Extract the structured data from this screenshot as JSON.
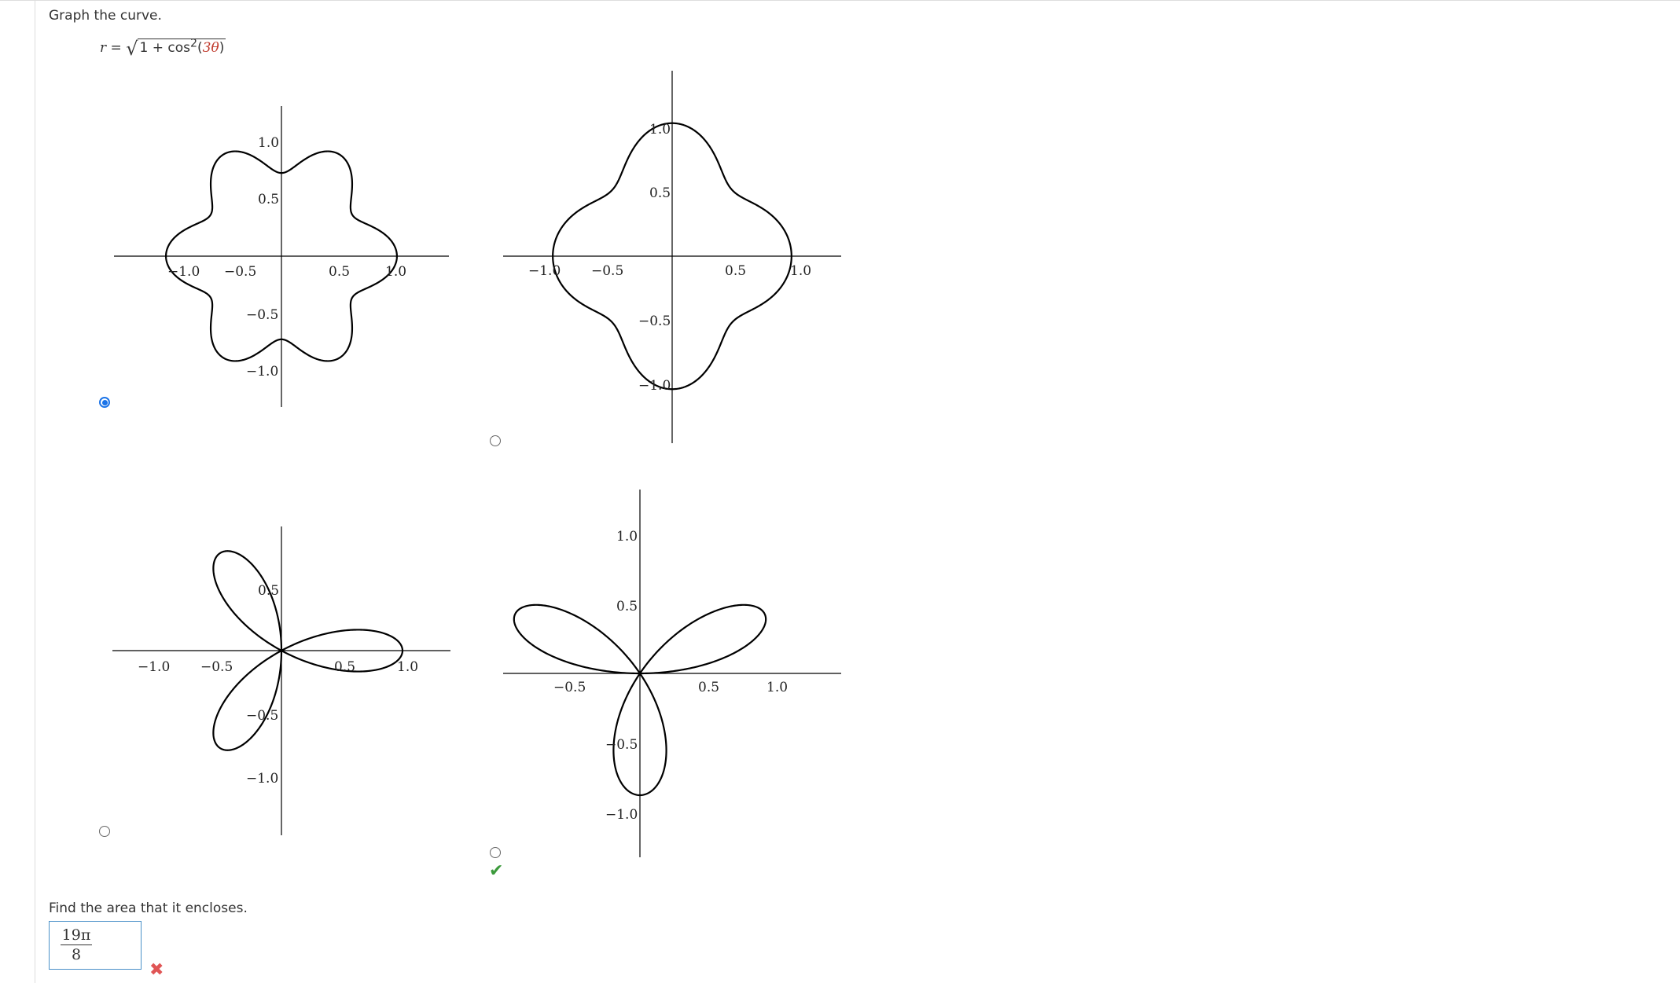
{
  "question": {
    "prompt": "Graph the curve.",
    "equation": {
      "lhs": "r =",
      "radicand_prefix": "1 + cos",
      "exponent": "2",
      "arg_open": "(",
      "arg_colored": "3θ",
      "arg_close": ")"
    }
  },
  "options": [
    {
      "id": "A",
      "selected": true,
      "marked_correct": false
    },
    {
      "id": "B",
      "selected": false,
      "marked_correct": false
    },
    {
      "id": "C",
      "selected": false,
      "marked_correct": false
    },
    {
      "id": "D",
      "selected": false,
      "marked_correct": true
    }
  ],
  "chart_data": [
    {
      "type": "line",
      "curve": "r = sqrt(1 + cos^2(3θ)) (polar)",
      "x_ticks": [
        "−1.0",
        "−0.5",
        "0.5",
        "1.0"
      ],
      "y_ticks": [
        "1.0",
        "0.5",
        "−0.5",
        "−1.0"
      ]
    },
    {
      "type": "line",
      "curve": "r = sqrt(1 + cos^2(2θ)) (polar)",
      "x_ticks": [
        "−1.0",
        "−0.5",
        "0.5",
        "1.0"
      ],
      "y_ticks": [
        "1.0",
        "0.5",
        "−0.5",
        "−1.0"
      ]
    },
    {
      "type": "line",
      "curve": "r = cos(3θ) (polar, three petals)",
      "x_ticks": [
        "−1.0",
        "−0.5",
        "0.5",
        "1.0"
      ],
      "y_ticks": [
        "0.5",
        "−0.5",
        "−1.0"
      ]
    },
    {
      "type": "line",
      "curve": "r = sin(3θ) (polar, three petals)",
      "x_ticks": [
        "−0.5",
        "0.5",
        "1.0"
      ],
      "y_ticks": [
        "1.0",
        "0.5",
        "−0.5",
        "−1.0"
      ]
    }
  ],
  "area_question": {
    "label": "Find the area that it encloses.",
    "answer_numerator": "19π",
    "answer_denominator": "8",
    "result": "incorrect",
    "status_colors": {
      "correct": "#3c9a3c",
      "incorrect": "#e05555",
      "selected": "#1a73e8"
    }
  }
}
